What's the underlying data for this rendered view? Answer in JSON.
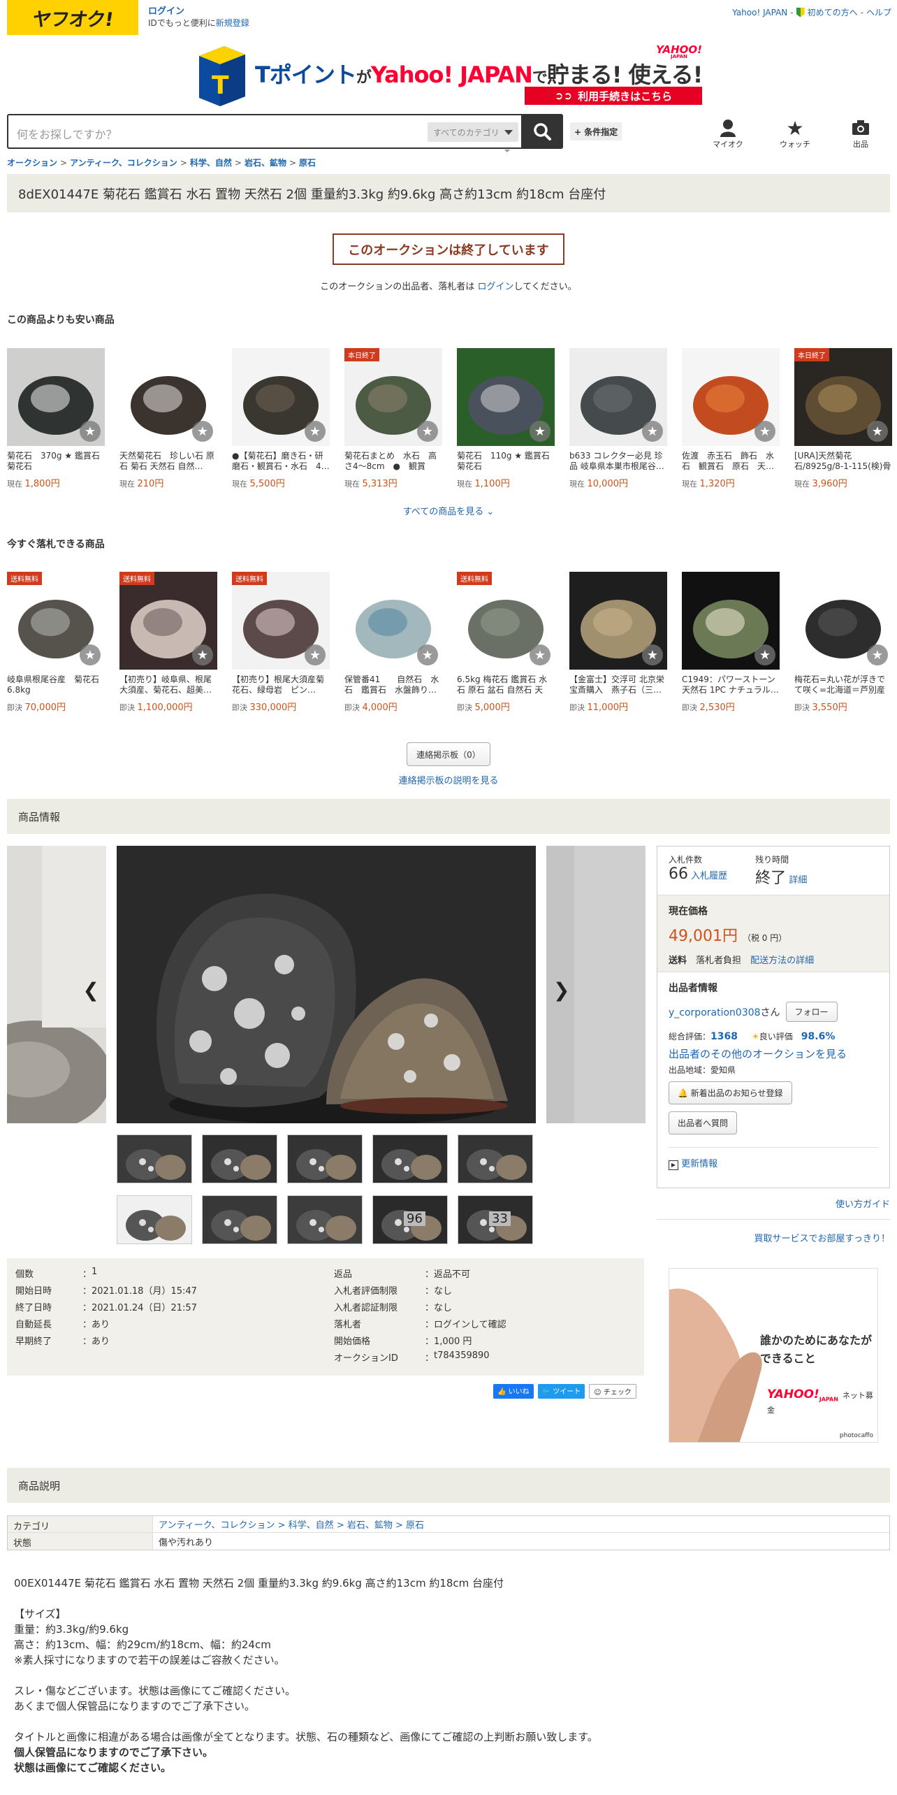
{
  "header": {
    "logo_text": "ヤフオク!",
    "login_label": "ログイン",
    "login_sub": "IDでもっと便利に",
    "register_label": "新規登録",
    "links": [
      "Yahoo! JAPAN",
      "初めての方へ",
      "ヘルプ"
    ],
    "banner": {
      "t_text": "Tポイント",
      "ga": "が",
      "yahoo": "Yahoo! JAPAN",
      "de": "で",
      "tamaru": "貯まる! 使える!",
      "corner_logo": "YAHOO!",
      "corner_sub": "JAPAN",
      "cta": "利用手続きはこちら"
    }
  },
  "search": {
    "placeholder": "何をお探しですか？",
    "category": "すべてのカテゴリ",
    "conditions": "+ 条件指定"
  },
  "header_icons": [
    {
      "label": "マイオク",
      "icon": "person-icon"
    },
    {
      "label": "ウォッチ",
      "icon": "star-icon"
    },
    {
      "label": "出品",
      "icon": "camera-icon"
    }
  ],
  "breadcrumb": [
    "オークション",
    "アンティーク、コレクション",
    "科学、自然",
    "岩石、鉱物",
    "原石"
  ],
  "item_title": "8dEX01447E 菊花石 鑑賞石 水石 置物 天然石 2個 重量約3.3kg 約9.6kg 高さ約13cm 約18cm 台座付",
  "ended": {
    "label": "このオークションは終了しています",
    "note_prefix": "このオークションの出品者、落札者は ",
    "note_link": "ログイン",
    "note_suffix": "してください。"
  },
  "cheaper": {
    "heading": "この商品よりも安い商品",
    "price_prefix": "現在",
    "items": [
      {
        "name": "菊花石　370g ★ 鑑賞石　菊花石",
        "price": "1,800円",
        "badge": ""
      },
      {
        "name": "天然菊花石　珍しい石 原石 菊石 天然石 自然…",
        "price": "210円",
        "badge": ""
      },
      {
        "name": "●【菊花石】磨き石・研磨石・観賞石・水石　4…",
        "price": "5,500円",
        "badge": ""
      },
      {
        "name": "菊花石まとめ　水石　高さ4～8cm　●　観賞石…",
        "price": "5,313円",
        "badge": "本日終了"
      },
      {
        "name": "菊花石　110g ★ 鑑賞石　菊花石",
        "price": "1,100円",
        "badge": ""
      },
      {
        "name": "b633 コレクター必見 珍品 岐阜県本巣市根尾谷…",
        "price": "10,000円",
        "badge": ""
      },
      {
        "name": "佐渡　赤玉石　飾石　水石　観賞石　原石　天…",
        "price": "1,320円",
        "badge": ""
      },
      {
        "name": "[URA]天然菊花石/8925g/8-1-115(検)骨董/天然石/…",
        "price": "3,960円",
        "badge": "本日終了"
      }
    ],
    "see_all": "すべての商品を見る"
  },
  "buynow": {
    "heading": "今すぐ落札できる商品",
    "price_prefix": "即決",
    "items": [
      {
        "name": "岐阜県根尾谷産　菊花石　6.8kg",
        "price": "70,000円",
        "badge": "送料無料"
      },
      {
        "name": "【初売り】岐阜県、根尾大須産、菊花石、超美…",
        "price": "1,100,000円",
        "badge": "送料無料"
      },
      {
        "name": "【初売り】根尾大須産菊花石、緑母岩　ピン…",
        "price": "330,000円",
        "badge": "送料無料"
      },
      {
        "name": "保管番41　　自然石　水石　鑑賞石　水盤飾り…",
        "price": "4,000円",
        "badge": ""
      },
      {
        "name": "6.5kg 梅花石 鑑賞石 水石 原石 盆石 自然石 天然…",
        "price": "5,000円",
        "badge": "送料無料"
      },
      {
        "name": "【金富士】交浮可 北京栄宝斎購入　燕子石（三…",
        "price": "11,000円",
        "badge": ""
      },
      {
        "name": "C1949：パワーストーン 天然石 1PC ナチュラル…",
        "price": "2,530円",
        "badge": ""
      },
      {
        "name": "梅花石=丸い花が浮きでて咲く=北海道＝芦別産",
        "price": "3,550円",
        "badge": ""
      }
    ]
  },
  "bbs": {
    "button": "連絡掲示板（0）",
    "link": "連絡掲示板の説明を見る"
  },
  "info_heading": "商品情報",
  "thumb_labels": [
    "",
    "",
    "",
    "",
    "",
    "",
    "",
    "",
    "96",
    "33"
  ],
  "bid": {
    "count_label": "入札件数",
    "count": "66",
    "history": "入札履歴",
    "remain_label": "残り時間",
    "remain": "終了",
    "detail": "詳細",
    "price_label": "現在価格",
    "price": "49,001円",
    "tax": "（税 0 円）",
    "shipping_label": "送料",
    "shipping_value": "落札者負担",
    "shipping_link": "配送方法の詳細",
    "seller_heading": "出品者情報",
    "seller": "y_corporation0308",
    "seller_suffix": "さん",
    "follow": "フォロー",
    "rating_label": "総合評価：",
    "rating": "1368",
    "good_label": "良い評価",
    "good": "98.6%",
    "other_auctions": "出品者のその他のオークションを見る",
    "region": "出品地域：愛知県",
    "notify": "新着出品のお知らせ登録",
    "question": "出品者へ質問",
    "update": "更新情報"
  },
  "usage_guide": "使い方ガイド",
  "kaitori": "買取サービスでお部屋すっきり！",
  "ad": {
    "line1": "誰かのためにあなたができること",
    "logo": "YAHOO!",
    "logo_sub": "JAPAN",
    "tagline": "ネット募金",
    "credit": "photocaffo"
  },
  "details": {
    "left": [
      {
        "k": "個数",
        "v": "1",
        "link": false
      },
      {
        "k": "開始日時",
        "v": "2021.01.18（月）15:47",
        "link": false
      },
      {
        "k": "終了日時",
        "v": "2021.01.24（日）21:57",
        "link": false
      },
      {
        "k": "自動延長",
        "v": "あり",
        "link": true
      },
      {
        "k": "早期終了",
        "v": "あり",
        "link": true
      }
    ],
    "right": [
      {
        "k": "返品",
        "v": "返品不可",
        "link": false,
        "vlink": false
      },
      {
        "k": "入札者評価制限",
        "v": "なし",
        "link": true,
        "vlink": false
      },
      {
        "k": "入札者認証制限",
        "v": "なし",
        "link": true,
        "vlink": false
      },
      {
        "k": "落札者",
        "v": "ログインして確認",
        "link": false,
        "vlink": true
      },
      {
        "k": "開始価格",
        "v": "1,000 円",
        "link": false,
        "vlink": false
      },
      {
        "k": "オークションID",
        "v": "t784359890",
        "link": false,
        "vlink": false
      }
    ]
  },
  "social": {
    "like": "いいね",
    "tweet": "ツイート",
    "check": "チェック"
  },
  "desc_heading": "商品説明",
  "cat_table": {
    "cat_label": "カテゴリ",
    "cat_value": "アンティーク、コレクション > 科学、自然 > 岩石、鉱物 > 原石",
    "cond_label": "状態",
    "cond_value": "傷や汚れあり"
  },
  "description": {
    "body": "00EX01447E 菊花石 鑑賞石 水石 置物 天然石 2個 重量約3.3kg 約9.6kg 高さ約13cm 約18cm 台座付\n\n【サイズ】\n重量：約3.3kg/約9.6kg\n高さ：約13cm、幅：約29cm/約18cm、幅：約24cm\n※素人採寸になりますので若干の誤差はご容赦ください。\n\nスレ・傷などございます。状態は画像にてご確認ください。\nあくまで個人保管品になりますのでご了承下さい。\n\nタイトルと画像に相違がある場合は画像が全てとなります。状態、石の種類など、画像にてご確認の上判断お願い致します。\n",
    "bold1": "個人保管品になりますのでご了承下さい。",
    "bold2": "状態は画像にてご確認ください。"
  },
  "colors": {
    "accent": "#d0521a",
    "link": "#1f66b0",
    "brand": "#ffd100",
    "panel": "#ecebe4"
  }
}
